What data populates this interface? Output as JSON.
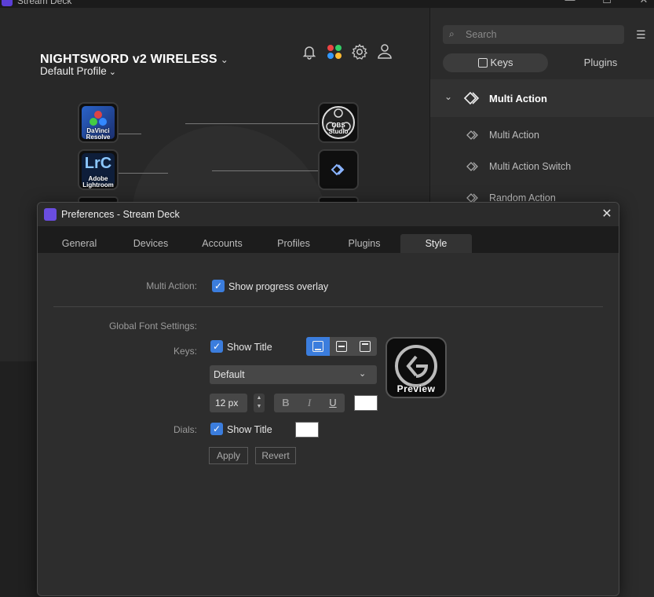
{
  "window": {
    "title": "Stream Deck",
    "minimize": "—",
    "maximize": "☐",
    "close": "✕"
  },
  "device": {
    "name": "NIGHTSWORD v2 WIRELESS",
    "profile": "Default Profile"
  },
  "keys": {
    "davinci": "DaVinci Resolve",
    "davinci_l1": "DaVinci",
    "davinci_l2": "Resolve",
    "lightroom": "Lightroom",
    "lrc": "LrC",
    "lightroom_l1": "Adobe",
    "lightroom_l2": "Lightroom",
    "obs_l1": "OBS",
    "obs_l2": "Studio"
  },
  "sidebar": {
    "search_placeholder": "Search",
    "tab_keys": "Keys",
    "tab_plugins": "Plugins",
    "category": "Multi Action",
    "items": [
      {
        "label": "Multi Action"
      },
      {
        "label": "Multi Action Switch"
      },
      {
        "label": "Random Action"
      }
    ]
  },
  "dialog": {
    "title": "Preferences - Stream Deck",
    "tabs": [
      "General",
      "Devices",
      "Accounts",
      "Profiles",
      "Plugins",
      "Style"
    ],
    "active_tab": "Style",
    "multi_action_label": "Multi Action:",
    "show_progress_overlay": "Show progress overlay",
    "global_font_label": "Global Font Settings:",
    "keys_label": "Keys:",
    "show_title": "Show Title",
    "font_family": "Default",
    "font_size": "12 px",
    "bold": "B",
    "italic": "I",
    "underline": "U",
    "dials_label": "Dials:",
    "dials_show_title": "Show Title",
    "preview_label": "Preview",
    "apply": "Apply",
    "revert": "Revert",
    "title_color": "#ffffff",
    "dials_title_color": "#ffffff",
    "accent_color": "#3b7ddd"
  }
}
